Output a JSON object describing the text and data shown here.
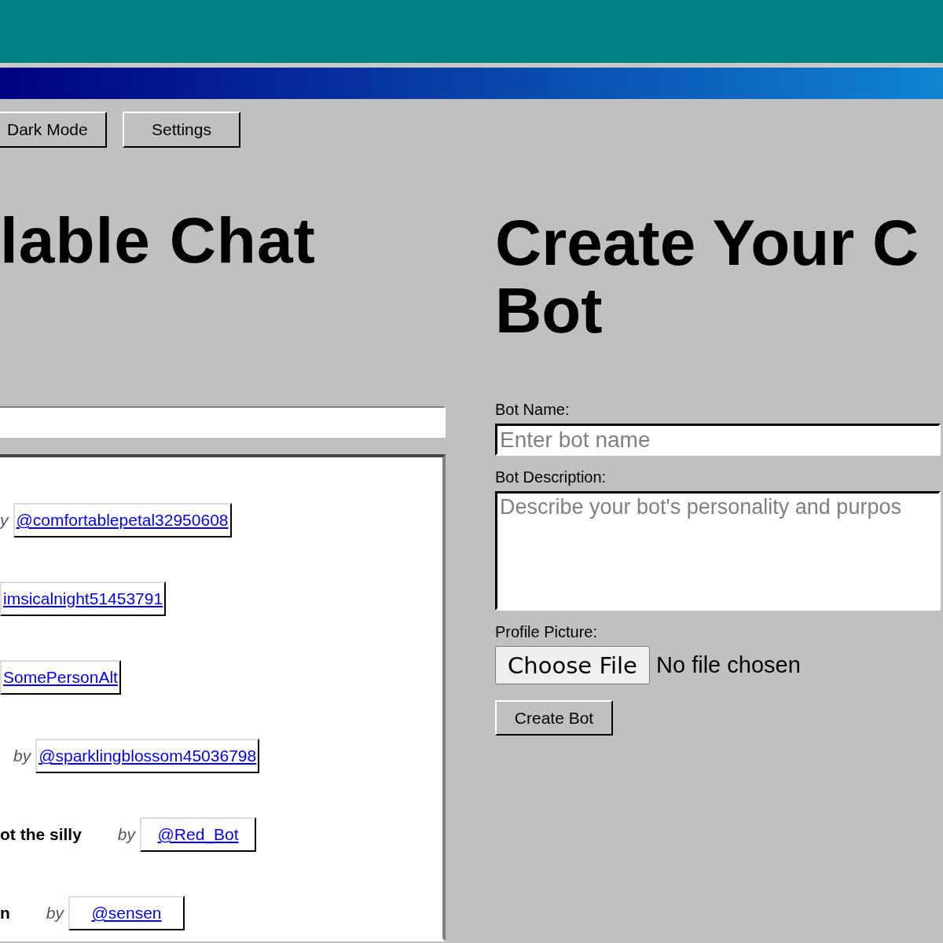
{
  "toolbar": {
    "buttons": [
      "Dark Mode",
      "Settings"
    ]
  },
  "chat_list": {
    "title": "lable Chat",
    "items": [
      {
        "by": "y",
        "author": "@comfortablepetal32950608"
      },
      {
        "author": "imsicalnight51453791"
      },
      {
        "author": "SomePersonAlt"
      },
      {
        "by": "by",
        "author": "@sparklingblossom45036798"
      },
      {
        "name": "ot the silly",
        "by": "by",
        "author": "@Red_Bot"
      },
      {
        "name": "n",
        "by": "by",
        "author": "@sensen"
      }
    ]
  },
  "create_bot": {
    "title_lines": [
      "Create Your C",
      "Bot"
    ],
    "fields": [
      {
        "kind": "text",
        "label": "Bot Name:",
        "placeholder": "Enter bot name"
      },
      {
        "kind": "textarea",
        "label": "Bot Description:",
        "placeholder": "Describe your bot's personality and purpos"
      }
    ],
    "profile_picture": {
      "label": "Profile Picture:",
      "button": "Choose File",
      "status": "No file chosen"
    },
    "submit": "Create Bot"
  }
}
